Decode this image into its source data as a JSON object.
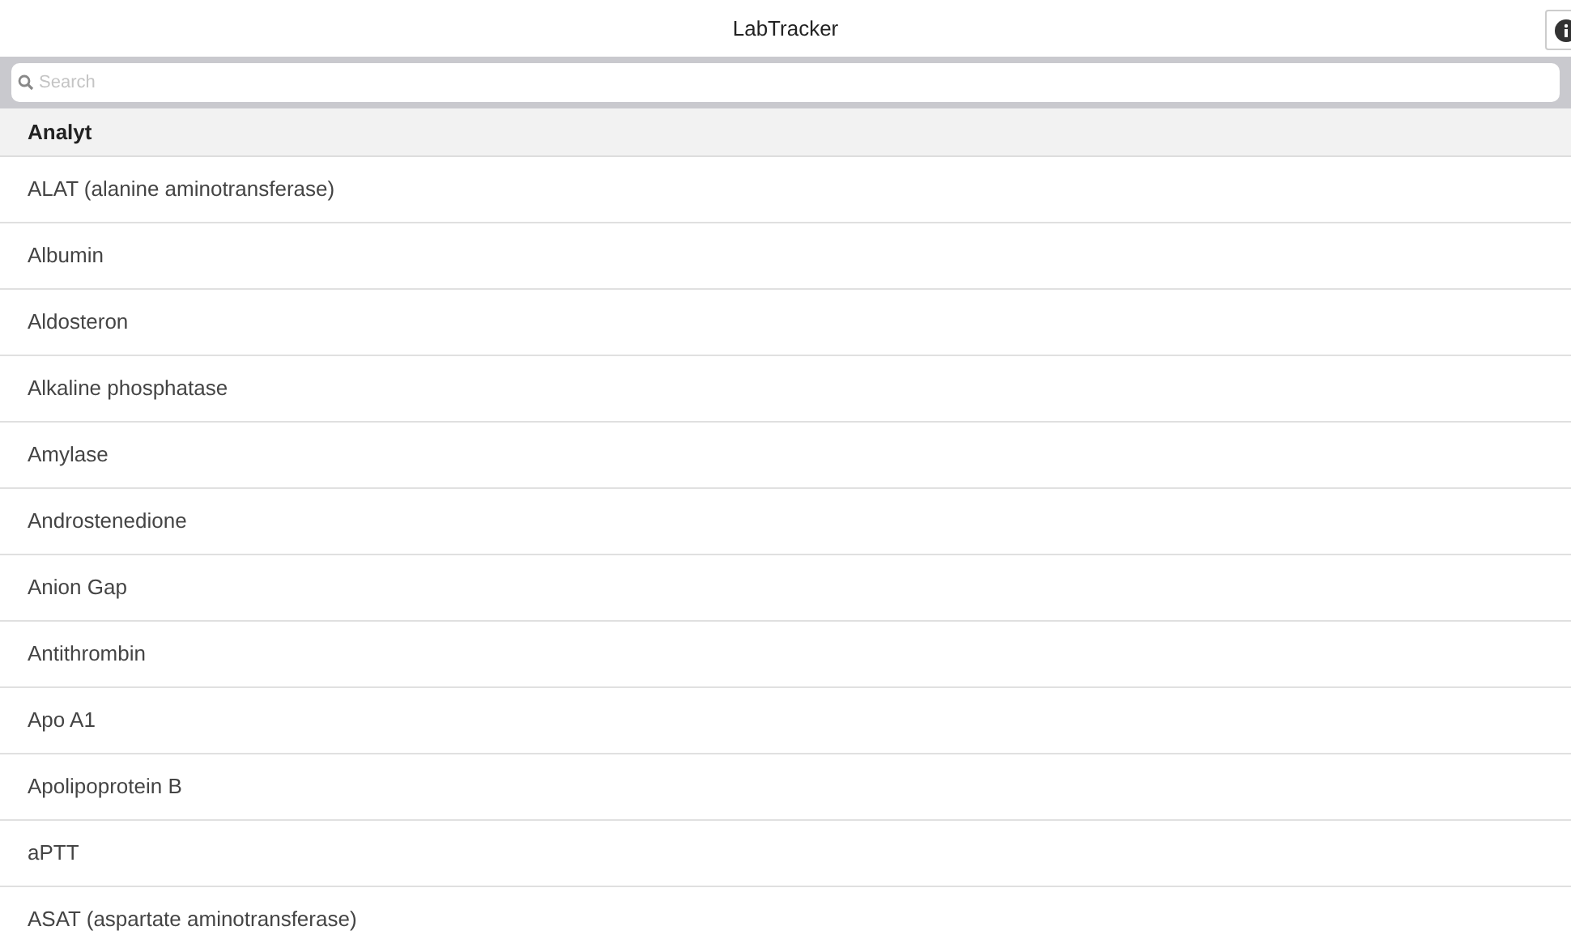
{
  "header": {
    "title": "LabTracker"
  },
  "search": {
    "placeholder": "Search"
  },
  "table": {
    "columns": [
      "Analyt"
    ],
    "rows": [
      "ALAT (alanine aminotransferase)",
      "Albumin",
      "Aldosteron",
      "Alkaline phosphatase",
      "Amylase",
      "Androstenedione",
      "Anion Gap",
      "Antithrombin",
      "Apo A1",
      "Apolipoprotein B",
      "aPTT",
      "ASAT (aspartate aminotransferase)"
    ]
  }
}
